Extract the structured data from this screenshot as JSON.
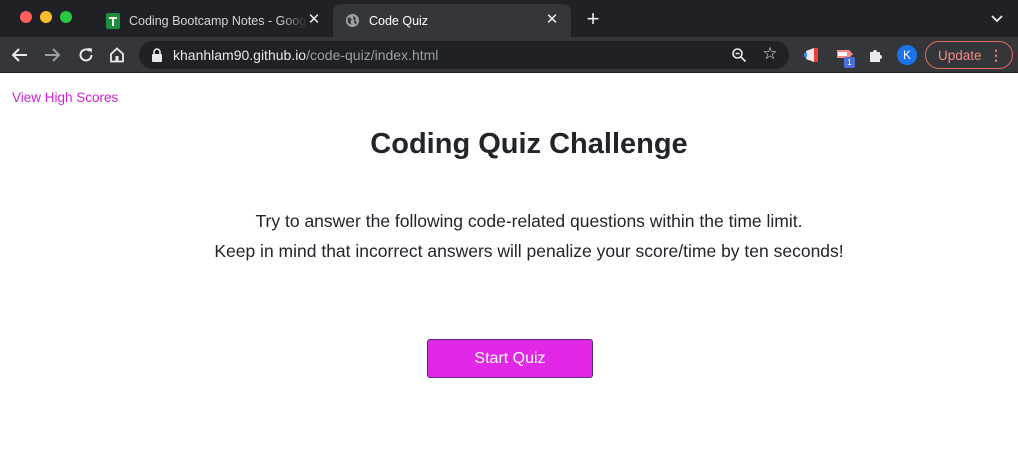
{
  "window": {
    "traffic_lights": [
      "close",
      "minimize",
      "zoom"
    ]
  },
  "tabs": [
    {
      "title": "Coding Bootcamp Notes - Google Sheets",
      "favicon": "sheets-icon",
      "active": false
    },
    {
      "title": "Code Quiz",
      "favicon": "globe-icon",
      "active": true
    }
  ],
  "toolbar": {
    "url_host": "khanhlam90.github.io",
    "url_path": "/code-quiz/index.html",
    "extension_badge": "1",
    "avatar_initial": "K",
    "update_label": "Update"
  },
  "page": {
    "high_scores_link": "View High Scores",
    "title": "Coding Quiz Challenge",
    "intro_line1": "Try to answer the following code-related questions within the time limit.",
    "intro_line2": "Keep in mind that incorrect answers will penalize your score/time by ten seconds!",
    "start_button": "Start Quiz"
  },
  "colors": {
    "link": "#d21fd6",
    "button": "#e327e6",
    "update_accent": "#f28b82"
  }
}
